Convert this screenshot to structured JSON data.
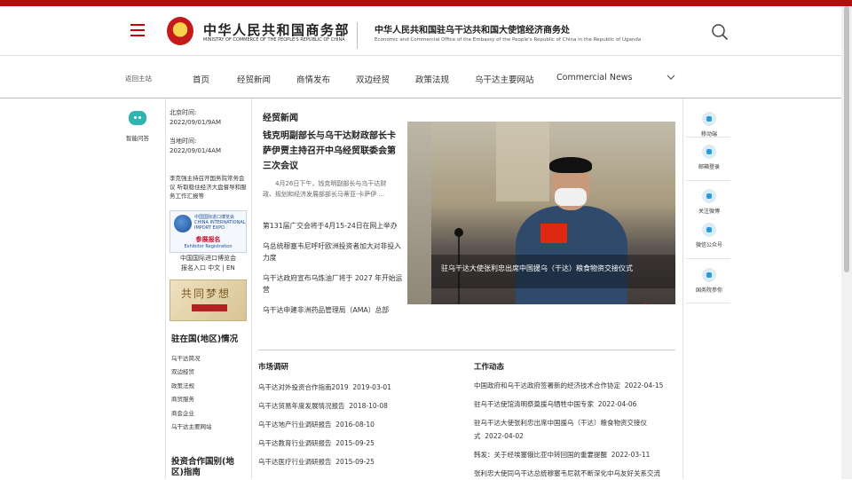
{
  "header": {
    "logo_cn": "中华人民共和国商务部",
    "logo_en": "MINISTRY OF COMMERCE OF THE PEOPLE'S REPUBLIC OF CHINA",
    "office_cn": "中华人民共和国驻乌干达共和国大使馆经济商务处",
    "office_en": "Economic and Commercial Office of the Embassy of the People's Republic of China in the Republic of Uganda",
    "colors": {
      "accent": "#b50d0d",
      "teal": "#2fb4b2",
      "blue": "#2a9bd6"
    }
  },
  "nav": {
    "back": "返回主站",
    "items": [
      "首页",
      "经贸新闻",
      "商情发布",
      "双边经贸",
      "政策法规",
      "乌干达主要网站",
      "Commercial News"
    ]
  },
  "left": {
    "ai_label": "智能问答",
    "beijing_time_label": "北京时间:",
    "beijing_time": "2022/09/01/9AM",
    "local_time_label": "当地时间:",
    "local_time": "2022/09/01/4AM",
    "notice": "李克强主持召开国务院常务会议 听取稳住经济大盘督导和服务工作汇报等",
    "expo_logo_cn": "中国国际进口博览会",
    "expo_logo_en": "CHINA INTERNATIONAL IMPORT EXPO",
    "expo_title": "参展报名",
    "expo_en": "Exhibitor Registration",
    "expo_caption_1": "中国国际进口博览会",
    "expo_caption_2": "报名入口 中文 | EN",
    "dream_text": "共同梦想",
    "country_heading": "驻在国(地区)情况",
    "country_links": [
      "乌干达简况",
      "双边经贸",
      "政策法规",
      "商贸服务",
      "商会企业",
      "乌干达主要网站"
    ],
    "invest_heading": "投资合作国别(地区)指南"
  },
  "news": {
    "heading": "经贸新闻",
    "lead_title": "钱克明副部长与乌干达财政部长卡萨伊贾主持召开中乌经贸联委会第三次会议",
    "lead_summary": "4月26日下午，钱克明副部长与乌干达财政、规划和经济发展部部长马蒂亚·卡萨伊 ...",
    "items": [
      "第131届广交会将于4月15-24日在网上举办",
      "乌总统穆塞韦尼呼吁欧洲投资者加大对非投入力度",
      "乌干达政府宣布乌炼油厂将于 2027 年开始运营",
      "乌干达申建非洲药品管理局（AMA）总部"
    ]
  },
  "carousel": {
    "caption": "驻乌干达大使张利忠出席中国援乌（干达）粮食物资交接仪式",
    "active_index": 2,
    "slide_count": 5
  },
  "market": {
    "heading": "市场调研",
    "items": [
      {
        "title": "乌干达对外投资合作指南2019",
        "date": "2019-03-01"
      },
      {
        "title": "乌干达贸易年度发展情况报告",
        "date": "2018-10-08"
      },
      {
        "title": "乌干达地产行业调研报告",
        "date": "2016-08-10"
      },
      {
        "title": "乌干达教育行业调研报告",
        "date": "2015-09-25"
      },
      {
        "title": "乌干达医疗行业调研报告",
        "date": "2015-09-25"
      }
    ]
  },
  "work": {
    "heading": "工作动态",
    "items": [
      {
        "title": "中国政府和乌干达政府签署新的经济技术合作协定",
        "date": "2022-04-15"
      },
      {
        "title": "驻乌干达使馆清明祭奠援乌牺牲中国专家",
        "date": "2022-04-06"
      },
      {
        "title": "驻乌干达大使张利忠出席中国援乌（干达）粮食物资交接仪式",
        "date": "2022-04-02"
      },
      {
        "title": "韩发：关于经埃塞俄比亚中转回国的重要提醒",
        "date": "2022-03-11"
      },
      {
        "title": "张利忠大使同乌干达总统穆塞韦尼就不断深化中乌友好关系交流",
        "date": ""
      }
    ]
  },
  "right": {
    "items": [
      "移动端",
      "邮箱登录",
      "关注微博",
      "微信公众号",
      "国务院参你"
    ]
  }
}
